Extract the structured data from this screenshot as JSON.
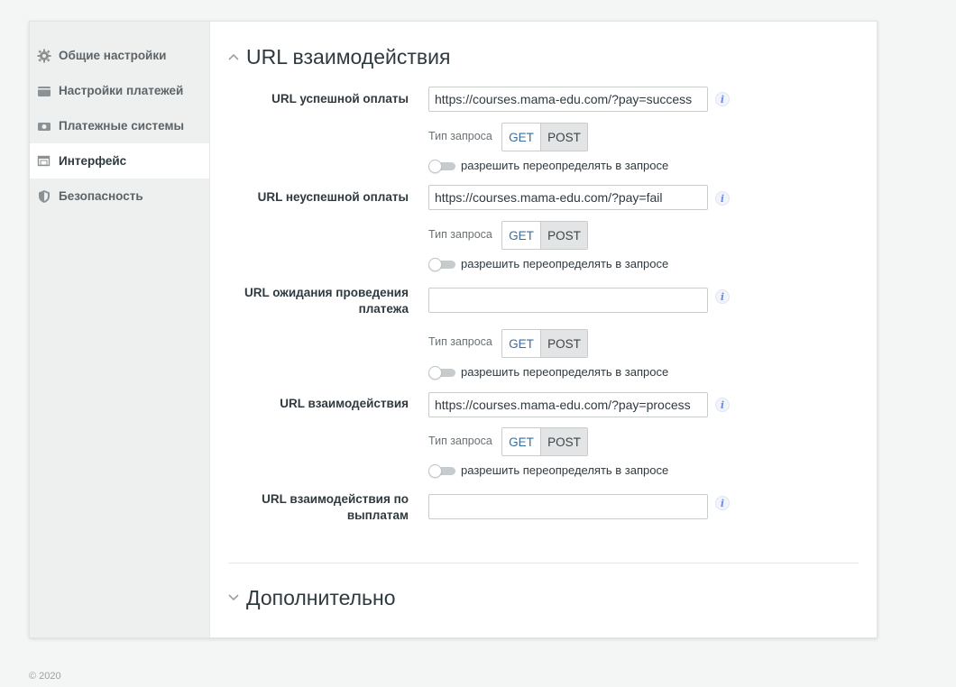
{
  "sidebar": {
    "items": [
      {
        "label": "Общие настройки",
        "icon": "gear-icon"
      },
      {
        "label": "Настройки платежей",
        "icon": "wallet-icon"
      },
      {
        "label": "Платежные системы",
        "icon": "money-icon"
      },
      {
        "label": "Интерфейс",
        "icon": "window-icon",
        "active": true
      },
      {
        "label": "Безопасность",
        "icon": "shield-icon"
      }
    ]
  },
  "section": {
    "title": "URL взаимодействия",
    "collapse_icon": "chevron-up-icon"
  },
  "fields": [
    {
      "label": "URL успешной оплаты",
      "value": "https://courses.mama-edu.com/?pay=success"
    },
    {
      "label": "URL неуспешной оплаты",
      "value": "https://courses.mama-edu.com/?pay=fail"
    },
    {
      "label_line1": "URL ожидания проведения",
      "label_line2": "платежа",
      "value": ""
    },
    {
      "label": "URL взаимодействия",
      "value": "https://courses.mama-edu.com/?pay=process"
    },
    {
      "label_line1": "URL взаимодействия по",
      "label_line2": "выплатам",
      "value": ""
    }
  ],
  "request": {
    "label": "Тип запроса",
    "get": "GET",
    "post": "POST",
    "selected": "POST",
    "override_label": "разрешить переопределять в запросе",
    "override_enabled": false
  },
  "extra_section": {
    "title": "Дополнительно",
    "expand_icon": "chevron-down-icon"
  },
  "footer": {
    "copyright": "© 2020"
  },
  "colors": {
    "link_blue": "#3d6d9c",
    "info_blue": "#6d8ee0",
    "sidebar_bg": "#eef0ef"
  }
}
